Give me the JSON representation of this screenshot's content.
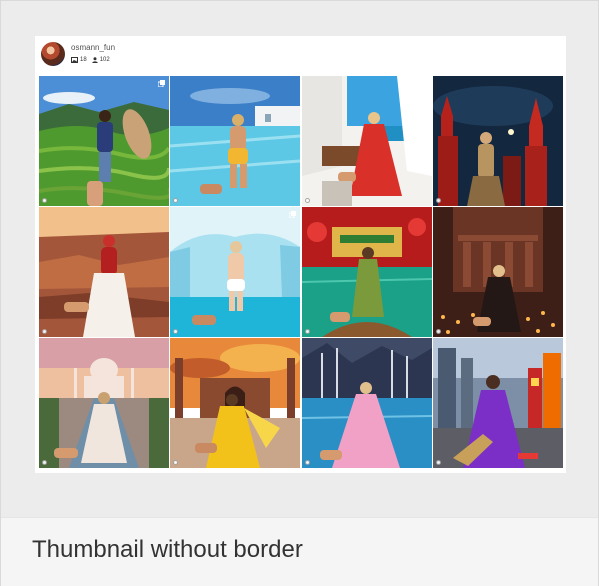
{
  "profile": {
    "username": "osmann_fun",
    "posts_count": "18",
    "followers_count": "102"
  },
  "caption": "Thumbnail without border",
  "colors": {
    "page_background": "#ececec",
    "card_background": "#ffffff",
    "caption_background": "#f5f5f5",
    "caption_text": "#333333"
  },
  "icons": {
    "posts": "image-icon",
    "followers": "user-icon",
    "multi_photo": "gallery-icon"
  },
  "photos": [
    {
      "scene": "woman with parasol on green terraced fields",
      "multi": true
    },
    {
      "scene": "woman in infinity pool, white buildings",
      "multi": false
    },
    {
      "scene": "woman in red dress on white rooftop",
      "multi": false
    },
    {
      "scene": "woman at Kremlin towers at night",
      "multi": false
    },
    {
      "scene": "woman in red vest over canyon",
      "multi": false
    },
    {
      "scene": "woman in ice cave with turquoise water",
      "multi": true
    },
    {
      "scene": "woman in green dress on boat by temple",
      "multi": false
    },
    {
      "scene": "woman at Petra with lanterns at night",
      "multi": false
    },
    {
      "scene": "woman at Taj Mahal at sunset",
      "multi": false
    },
    {
      "scene": "woman in yellow dress at mosque",
      "multi": false
    },
    {
      "scene": "woman in pink dress on blue lake",
      "multi": false
    },
    {
      "scene": "woman in purple dress in neon city street",
      "multi": false
    }
  ]
}
